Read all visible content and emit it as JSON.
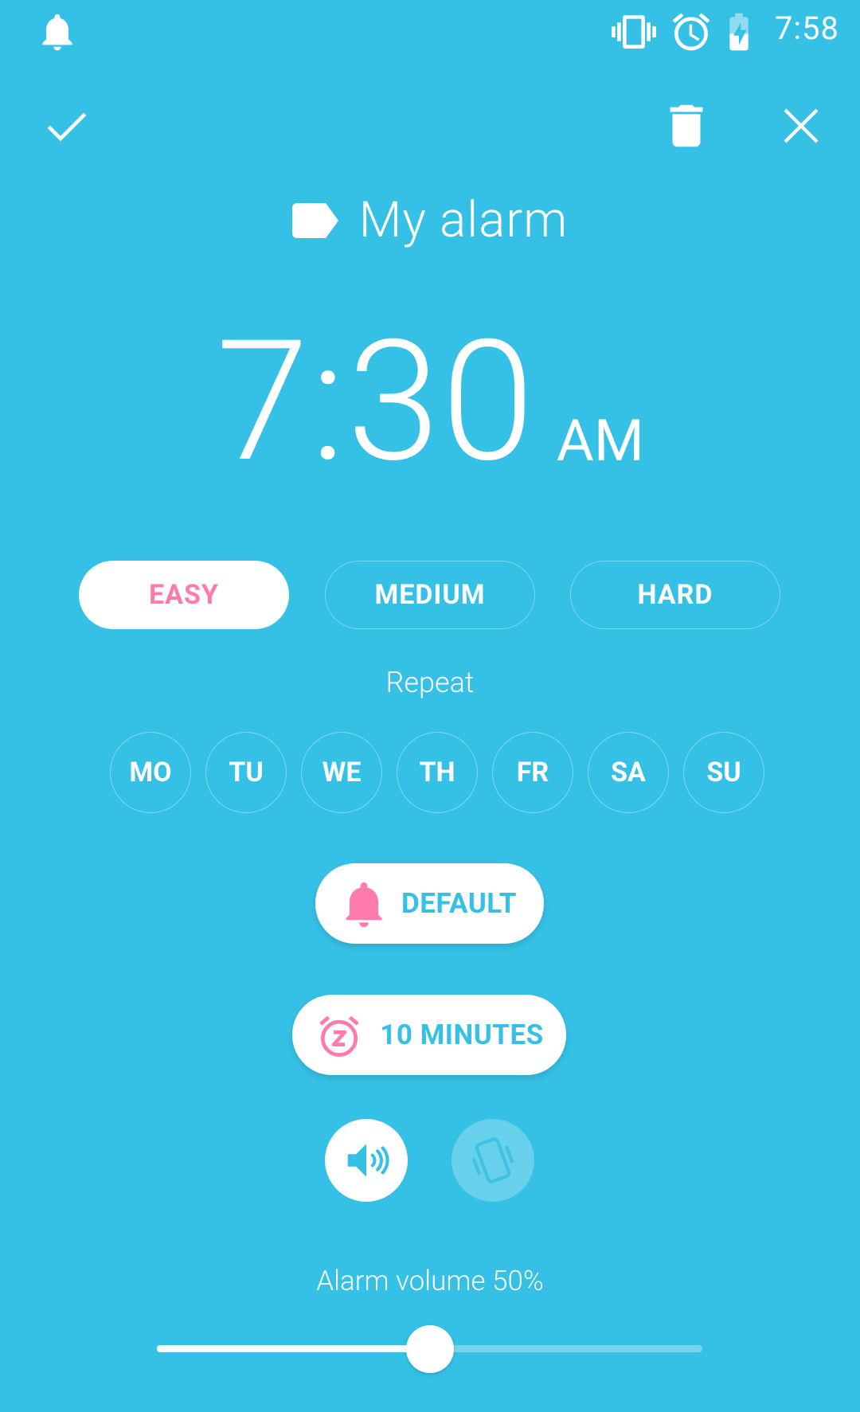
{
  "status_bar": {
    "time": "7:58",
    "icons": [
      "notification-bell-icon",
      "vibrate-icon",
      "alarm-clock-icon",
      "battery-charging-icon"
    ]
  },
  "toolbar": {
    "confirm_icon": "check-icon",
    "delete_icon": "trash-icon",
    "close_icon": "close-icon"
  },
  "alarm": {
    "label_icon": "label-tag-icon",
    "label": "My alarm",
    "time": "7:30",
    "period": "AM"
  },
  "difficulty": {
    "options": [
      "EASY",
      "MEDIUM",
      "HARD"
    ],
    "selected": "EASY"
  },
  "repeat": {
    "label": "Repeat",
    "days": [
      "MO",
      "TU",
      "WE",
      "TH",
      "FR",
      "SA",
      "SU"
    ]
  },
  "sound": {
    "icon": "bell-icon",
    "label": "DEFAULT"
  },
  "snooze": {
    "icon": "snooze-clock-icon",
    "label": "10 MINUTES"
  },
  "modes": {
    "sound_icon": "speaker-icon",
    "sound_enabled": true,
    "vibrate_icon": "phone-vibrate-icon",
    "vibrate_enabled": false
  },
  "volume": {
    "label": "Alarm volume 50%",
    "level": 0.5
  },
  "colors": {
    "background": "#35c1e5",
    "accent_pink": "#ff7bac",
    "white": "#ffffff"
  }
}
